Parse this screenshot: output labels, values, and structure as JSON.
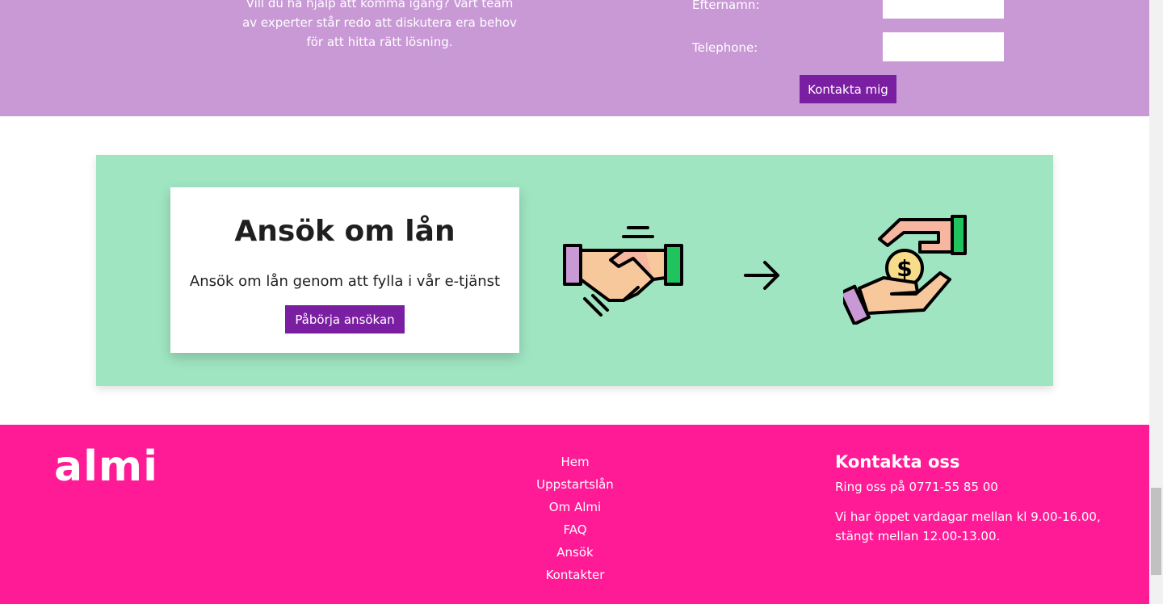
{
  "contact": {
    "intro_text": "Vill du ha hjälp att komma igång? Vårt team av experter står redo att diskutera era behov för att hitta rätt lösning.",
    "efternamn_label": "Efternamn:",
    "telephone_label": "Telephone:",
    "button_label": "Kontakta mig"
  },
  "apply": {
    "title": "Ansök om lån",
    "description": "Ansök om lån genom att fylla i vår e-tjänst",
    "button_label": "Påbörja ansökan",
    "icons": [
      "handshake-icon",
      "arrow-right-icon",
      "hand-coin-icon"
    ]
  },
  "footer": {
    "logo": "almi",
    "nav": [
      {
        "label": "Hem"
      },
      {
        "label": "Uppstartslån"
      },
      {
        "label": "Om Almi"
      },
      {
        "label": "FAQ"
      },
      {
        "label": "Ansök"
      },
      {
        "label": "Kontakter"
      }
    ],
    "contact_heading": "Kontakta oss",
    "phone_text": "Ring oss på 0771-55 85 00",
    "hours_text": "Vi har öppet vardagar mellan kl 9.00-16.00, stängt mellan 12.00-13.00."
  },
  "colors": {
    "contact_bg": "#c999d6",
    "banner_bg": "#9fe5c1",
    "footer_bg": "#ff1a96",
    "button_bg": "#7b1fa2"
  }
}
